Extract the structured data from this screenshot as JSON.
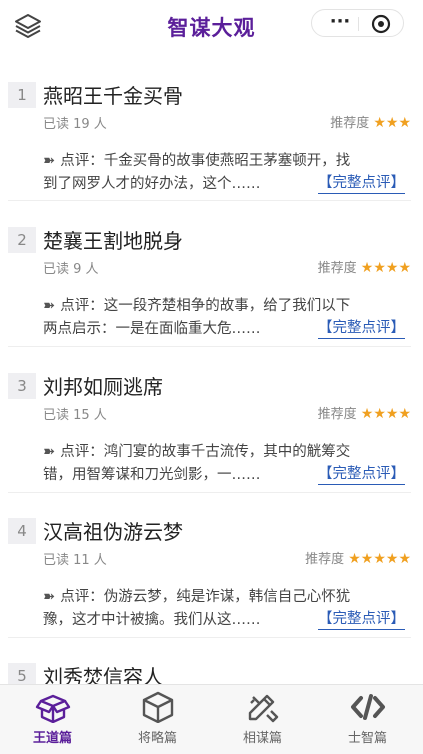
{
  "header": {
    "title": "智谋大观",
    "more": "···"
  },
  "items": [
    {
      "num": "1",
      "title": "燕昭王千金买骨",
      "reads": "已读 19 人",
      "rec_label": "推荐度",
      "stars": "★★★",
      "review_line1": "点评：千金买骨的故事使燕昭王茅塞顿开，找",
      "review_line2": "到了网罗人才的好办法，这个……",
      "full": "【完整点评】"
    },
    {
      "num": "2",
      "title": "楚襄王割地脱身",
      "reads": "已读 9 人",
      "rec_label": "推荐度",
      "stars": "★★★★",
      "review_line1": "点评：这一段齐楚相争的故事，给了我们以下",
      "review_line2": "两点启示：一是在面临重大危……",
      "full": "【完整点评】"
    },
    {
      "num": "3",
      "title": "刘邦如厕逃席",
      "reads": "已读 15 人",
      "rec_label": "推荐度",
      "stars": "★★★★",
      "review_line1": "点评：鸿门宴的故事千古流传，其中的觥筹交",
      "review_line2": "错，用智筹谋和刀光剑影，一……",
      "full": "【完整点评】"
    },
    {
      "num": "4",
      "title": "汉高祖伪游云梦",
      "reads": "已读 11 人",
      "rec_label": "推荐度",
      "stars": "★★★★★",
      "review_line1": "点评：伪游云梦，纯是诈谋，韩信自己心怀犹",
      "review_line2": "豫，这才中计被擒。我们从这……",
      "full": "【完整点评】"
    },
    {
      "num": "5",
      "title": "刘秀焚信容人"
    }
  ],
  "tabs": [
    {
      "label": "王道篇",
      "icon": "box-open-icon",
      "active": true
    },
    {
      "label": "将略篇",
      "icon": "cube-icon",
      "active": false
    },
    {
      "label": "相谋篇",
      "icon": "pencil-ruler-icon",
      "active": false
    },
    {
      "label": "士智篇",
      "icon": "code-icon",
      "active": false
    }
  ],
  "colors": {
    "accent": "#5b1f9a",
    "star": "#f0a020",
    "link": "#2a5bb6"
  }
}
